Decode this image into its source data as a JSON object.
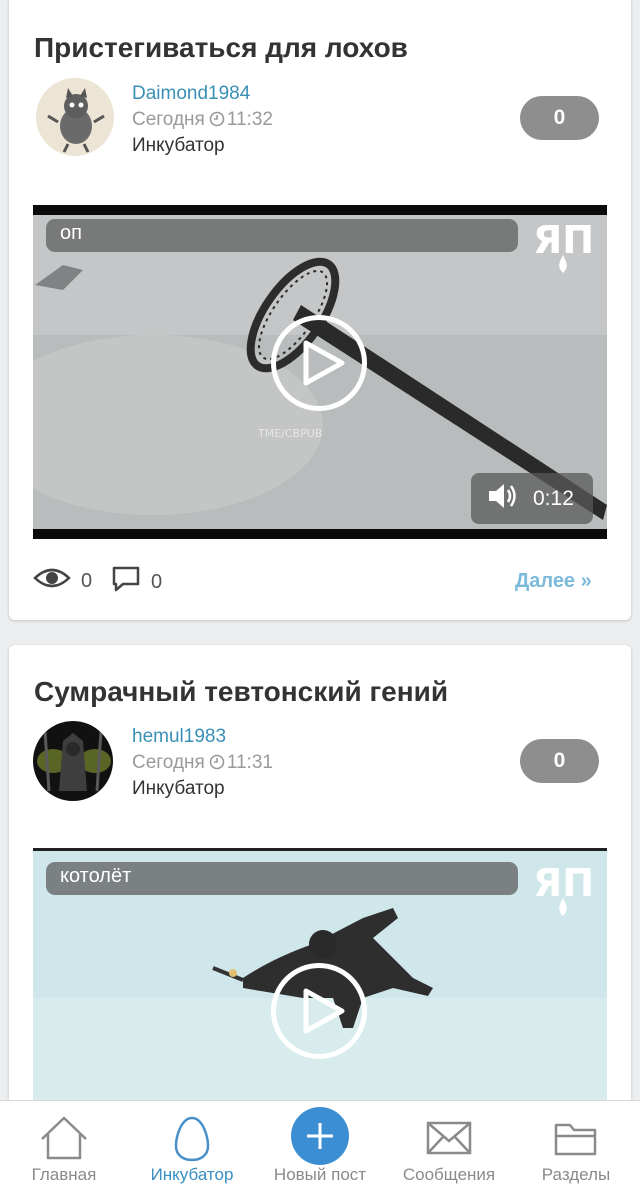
{
  "posts": [
    {
      "title": "Пристегиваться для лохов",
      "author": "Daimond1984",
      "date_label": "Сегодня",
      "time": "11:32",
      "section": "Инкубатор",
      "rating": "0",
      "video_caption": "оп",
      "video_watermark": "TME/CBPUB",
      "video_duration": "0:12",
      "views": "0",
      "comments": "0",
      "more_label": "Далее »"
    },
    {
      "title": "Сумрачный тевтонский гений",
      "author": "hemul1983",
      "date_label": "Сегодня",
      "time": "11:31",
      "section": "Инкубатор",
      "rating": "0",
      "video_caption": "котолёт"
    }
  ],
  "logo_text": "ЯП",
  "bottom_nav": {
    "items": [
      {
        "label": "Главная",
        "icon": "home-icon",
        "active": false
      },
      {
        "label": "Инкубатор",
        "icon": "egg-icon",
        "active": true
      },
      {
        "label": "Новый пост",
        "icon": "plus-icon",
        "active": false
      },
      {
        "label": "Сообщения",
        "icon": "envelope-icon",
        "active": false
      },
      {
        "label": "Разделы",
        "icon": "folder-icon",
        "active": false
      }
    ]
  },
  "colors": {
    "accent": "#3a8fb5",
    "link": "#7cbadc",
    "fab": "#3c8ed3",
    "rating_bg": "#8e8e8e"
  }
}
